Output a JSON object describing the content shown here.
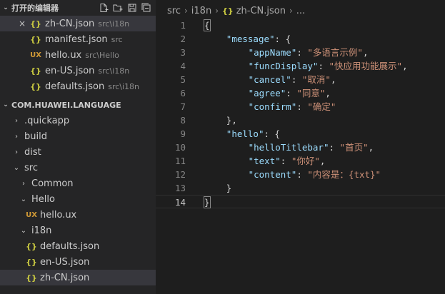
{
  "open_editors": {
    "title": "打开的编辑器",
    "files": [
      {
        "name": "zh-CN.json",
        "path": "src\\i18n",
        "type": "json",
        "active": true
      },
      {
        "name": "manifest.json",
        "path": "src",
        "type": "json"
      },
      {
        "name": "hello.ux",
        "path": "src\\Hello",
        "type": "ux"
      },
      {
        "name": "en-US.json",
        "path": "src\\i18n",
        "type": "json"
      },
      {
        "name": "defaults.json",
        "path": "src\\i18n",
        "type": "json"
      }
    ],
    "close_glyph": "×"
  },
  "project": {
    "title": "COM.HUAWEI.LANGUAGE",
    "tree": [
      {
        "label": ".quickapp",
        "kind": "folder",
        "expanded": false,
        "depth": 0
      },
      {
        "label": "build",
        "kind": "folder",
        "expanded": false,
        "depth": 0
      },
      {
        "label": "dist",
        "kind": "folder",
        "expanded": false,
        "depth": 0
      },
      {
        "label": "src",
        "kind": "folder",
        "expanded": true,
        "depth": 0
      },
      {
        "label": "Common",
        "kind": "folder",
        "expanded": false,
        "depth": 1
      },
      {
        "label": "Hello",
        "kind": "folder",
        "expanded": true,
        "depth": 1
      },
      {
        "label": "hello.ux",
        "kind": "ux",
        "depth": 2
      },
      {
        "label": "i18n",
        "kind": "folder",
        "expanded": true,
        "depth": 1
      },
      {
        "label": "defaults.json",
        "kind": "json",
        "depth": 2
      },
      {
        "label": "en-US.json",
        "kind": "json",
        "depth": 2
      },
      {
        "label": "zh-CN.json",
        "kind": "json",
        "depth": 2,
        "selected": true
      }
    ]
  },
  "icons": {
    "json": "{}",
    "ux": "UX",
    "collapsed": "›",
    "expanded": "⌄",
    "section_open": "⌄"
  },
  "breadcrumb": {
    "parts": [
      "src",
      "i18n",
      "zh-CN.json",
      "..."
    ],
    "separator": "›"
  },
  "editor": {
    "current_line": 14,
    "lines": [
      {
        "n": 1,
        "indent": 0,
        "tokens": [
          [
            "p",
            "{"
          ]
        ]
      },
      {
        "n": 2,
        "indent": 4,
        "tokens": [
          [
            "k",
            "\"message\""
          ],
          [
            "p",
            ": {"
          ]
        ]
      },
      {
        "n": 3,
        "indent": 8,
        "tokens": [
          [
            "k",
            "\"appName\""
          ],
          [
            "p",
            ": "
          ],
          [
            "s",
            "\"多语言示例\""
          ],
          [
            "p",
            ","
          ]
        ]
      },
      {
        "n": 4,
        "indent": 8,
        "tokens": [
          [
            "k",
            "\"funcDisplay\""
          ],
          [
            "p",
            ": "
          ],
          [
            "s",
            "\"快应用功能展示\""
          ],
          [
            "p",
            ","
          ]
        ]
      },
      {
        "n": 5,
        "indent": 8,
        "tokens": [
          [
            "k",
            "\"cancel\""
          ],
          [
            "p",
            ": "
          ],
          [
            "s",
            "\"取消\""
          ],
          [
            "p",
            ","
          ]
        ]
      },
      {
        "n": 6,
        "indent": 8,
        "tokens": [
          [
            "k",
            "\"agree\""
          ],
          [
            "p",
            ": "
          ],
          [
            "s",
            "\"同意\""
          ],
          [
            "p",
            ","
          ]
        ]
      },
      {
        "n": 7,
        "indent": 8,
        "tokens": [
          [
            "k",
            "\"confirm\""
          ],
          [
            "p",
            ": "
          ],
          [
            "s",
            "\"确定\""
          ]
        ]
      },
      {
        "n": 8,
        "indent": 4,
        "tokens": [
          [
            "p",
            "},"
          ]
        ]
      },
      {
        "n": 9,
        "indent": 4,
        "tokens": [
          [
            "k",
            "\"hello\""
          ],
          [
            "p",
            ": {"
          ]
        ]
      },
      {
        "n": 10,
        "indent": 8,
        "tokens": [
          [
            "k",
            "\"helloTitlebar\""
          ],
          [
            "p",
            ": "
          ],
          [
            "s",
            "\"首页\""
          ],
          [
            "p",
            ","
          ]
        ]
      },
      {
        "n": 11,
        "indent": 8,
        "tokens": [
          [
            "k",
            "\"text\""
          ],
          [
            "p",
            ": "
          ],
          [
            "s",
            "\"你好\""
          ],
          [
            "p",
            ","
          ]
        ]
      },
      {
        "n": 12,
        "indent": 8,
        "tokens": [
          [
            "k",
            "\"content\""
          ],
          [
            "p",
            ": "
          ],
          [
            "s",
            "\"内容是：{txt}\""
          ]
        ]
      },
      {
        "n": 13,
        "indent": 4,
        "tokens": [
          [
            "p",
            "}"
          ]
        ]
      },
      {
        "n": 14,
        "indent": 0,
        "tokens": [
          [
            "p",
            "}"
          ]
        ]
      }
    ]
  },
  "colors": {
    "key": "#9cdcfe",
    "string": "#ce9178",
    "json_icon": "#cbcb41",
    "ux_icon": "#d19a36",
    "selection": "#37373d"
  }
}
